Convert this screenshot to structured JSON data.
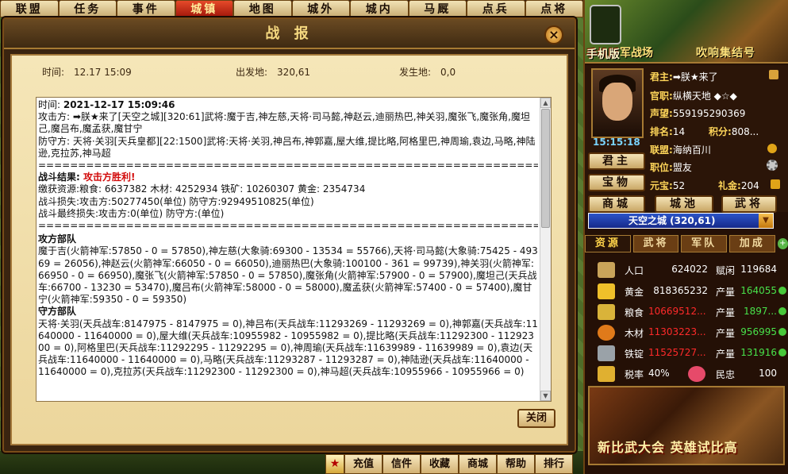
{
  "nav": [
    "联盟",
    "任务",
    "事件",
    "城镇",
    "地图",
    "城外",
    "城内",
    "马厩",
    "点兵",
    "点将"
  ],
  "modal": {
    "title": "战 报",
    "time_label": "时间:",
    "time_value": "12.17 15:09",
    "origin_label": "出发地:",
    "origin_value": "320,61",
    "location_label": "发生地:",
    "location_value": "0,0",
    "close_label": "关闭"
  },
  "report": {
    "time_prefix": "时间: ",
    "time": "2021-12-17 15:09:46",
    "attacker": "攻击方: ➡朕★来了[天空之城][320:61]武将:魔于吉,神左慈,天将·司马懿,神赵云,迪丽热巴,神关羽,魔张飞,魔张角,魔坦己,魔吕布,魔孟获,魔甘宁",
    "defender": "防守方: 天将·关羽[天兵皇都][22:1500]武将:天将·关羽,神吕布,神郭嘉,屋大维,提比略,阿格里巴,神周瑜,袁边,马略,神陆逊,克拉苏,神马超",
    "sep": "========================================================================",
    "result_label": "战斗结果: ",
    "result": "攻击方胜利!",
    "loot": "缴获资源:粮食: 6637382 木材: 4252934 铁矿: 10260307 黄金: 2354734",
    "loss": "战斗损失:攻击方:50277450(单位) 防守方:92949510825(单位)",
    "final_loss": "战斗最终损失:攻击方:0(单位) 防守方:(单位)",
    "atk_title": "攻方部队",
    "atk_units": "魔于吉(火箭神军:57850 - 0 = 57850),神左慈(大象骑:69300 - 13534 = 55766),天将·司马懿(大象骑:75425 - 49369 = 26056),神赵云(火箭神军:66050 - 0 = 66050),迪丽热巴(大象骑:100100 - 361 = 99739),神关羽(火箭神军:66950 - 0 = 66950),魔张飞(火箭神军:57850 - 0 = 57850),魔张角(火箭神军:57900 - 0 = 57900),魔坦己(天兵战车:66700 - 13230 = 53470),魔吕布(火箭神军:58000 - 0 = 58000),魔孟获(火箭神军:57400 - 0 = 57400),魔甘宁(火箭神军:59350 - 0 = 59350)",
    "def_title": "守方部队",
    "def_units": "天将·关羽(天兵战车:8147975 - 8147975 = 0),神吕布(天兵战车:11293269 - 11293269 = 0),神郭嘉(天兵战车:11640000 - 11640000 = 0),屋大维(天兵战车:10955982 - 10955982 = 0),提比略(天兵战车:11292300 - 11292300 = 0),阿格里巴(天兵战车:11292295 - 11292295 = 0),神周瑜(天兵战车:11639989 - 11639989 = 0),袁边(天兵战车:11640000 - 11640000 = 0),马略(天兵战车:11293287 - 11293287 = 0),神陆逊(天兵战车:11640000 - 11640000 = 0),克拉苏(天兵战车:11292300 - 11292300 = 0),神马超(天兵战车:10955966 - 10955966 = 0)"
  },
  "bottom": [
    "充值",
    "信件",
    "收藏",
    "商城",
    "帮助",
    "排行"
  ],
  "banner": {
    "t1": "手机版",
    "t2": "军战场",
    "t3": "吹响集结号"
  },
  "player": {
    "lord_label": "君主:",
    "lord": "➡朕★来了",
    "title_label": "官职:",
    "title": "纵横天地",
    "title_stars": "◆☆◆",
    "fame_label": "声望:",
    "fame": "559195290369",
    "rank_label": "排名:",
    "rank": "14",
    "score_label": "积分:",
    "score": "808...",
    "alliance_label": "联盟:",
    "alliance": "海纳百川",
    "position_label": "职位:",
    "position": "盟友",
    "yuanbao_label": "元宝:",
    "yuanbao": "52",
    "gift_label": "礼金:",
    "gift": "204",
    "clock": "15:15:18"
  },
  "pbuttons": {
    "lord": "君主",
    "treasure": "宝物",
    "shop": "商城",
    "city": "城池",
    "general": "武将"
  },
  "city_select": "天空之城 (320,61)",
  "rtabs": [
    "资源",
    "武将",
    "军队",
    "加成"
  ],
  "resources": {
    "pop_label": "人口",
    "pop": "624022",
    "idle_label": "赋闲",
    "idle": "119684",
    "gold_label": "黄金",
    "gold": "818365232",
    "gold_out_label": "产量",
    "gold_out": "164055",
    "food_label": "粮食",
    "food": "10669512...",
    "food_out_label": "产量",
    "food_out": "1897...",
    "wood_label": "木材",
    "wood": "11303223...",
    "wood_out_label": "产量",
    "wood_out": "956995",
    "iron_label": "铁锭",
    "iron": "11525727...",
    "iron_out_label": "产量",
    "iron_out": "131916",
    "tax_label": "税率",
    "tax": "40%",
    "morale_label": "民忠",
    "morale": "100"
  },
  "ad": "新比武大会 英雄试比高"
}
